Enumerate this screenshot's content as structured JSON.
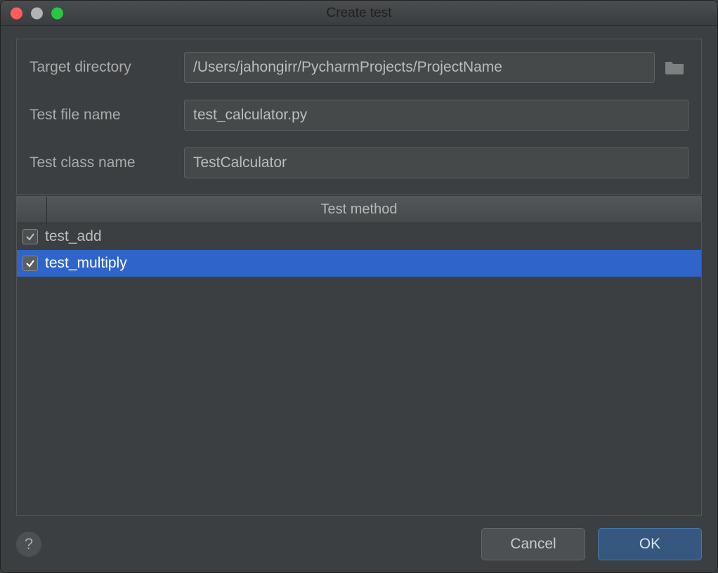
{
  "window": {
    "title": "Create test"
  },
  "form": {
    "target_directory": {
      "label": "Target directory",
      "value": "/Users/jahongirr/PycharmProjects/ProjectName"
    },
    "test_file_name": {
      "label": "Test file name",
      "value": "test_calculator.py"
    },
    "test_class_name": {
      "label": "Test class name",
      "value": "TestCalculator"
    }
  },
  "table": {
    "header": "Test method",
    "rows": [
      {
        "name": "test_add",
        "checked": true,
        "selected": false
      },
      {
        "name": "test_multiply",
        "checked": true,
        "selected": true
      }
    ]
  },
  "footer": {
    "help": "?",
    "cancel": "Cancel",
    "ok": "OK"
  },
  "icons": {
    "browse": "folder-open-icon"
  }
}
